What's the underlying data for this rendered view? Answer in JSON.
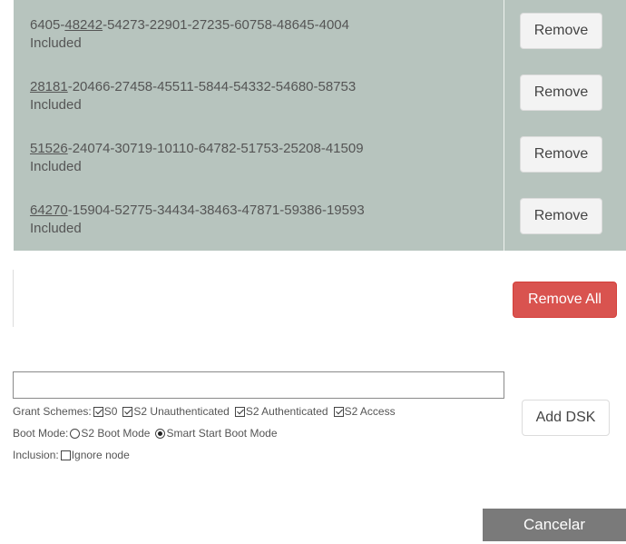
{
  "dsk_list": [
    {
      "prefix": "6405-",
      "underlined": "48242",
      "suffix": "-54273-22901-27235-60758-48645-4004",
      "status": "Included",
      "remove_label": "Remove"
    },
    {
      "prefix": "",
      "underlined": "28181",
      "suffix": "-20466-27458-45511-5844-54332-54680-58753",
      "status": "Included",
      "remove_label": "Remove"
    },
    {
      "prefix": "",
      "underlined": "51526",
      "suffix": "-24074-30719-10110-64782-51753-25208-41509",
      "status": "Included",
      "remove_label": "Remove"
    },
    {
      "prefix": "",
      "underlined": "64270",
      "suffix": "-15904-52775-34434-38463-47871-59386-19593",
      "status": "Included",
      "remove_label": "Remove"
    }
  ],
  "remove_all_label": "Remove All",
  "add_form": {
    "dsk_input_value": "",
    "grant_schemes": {
      "label": "Grant Schemes:",
      "options": [
        {
          "label": "S0",
          "checked": true
        },
        {
          "label": "S2 Unauthenticated",
          "checked": true
        },
        {
          "label": "S2 Authenticated",
          "checked": true
        },
        {
          "label": "S2 Access",
          "checked": true
        }
      ]
    },
    "boot_mode": {
      "label": "Boot Mode:",
      "options": [
        {
          "label": "S2 Boot Mode",
          "checked": false
        },
        {
          "label": "Smart Start Boot Mode",
          "checked": true
        }
      ]
    },
    "inclusion": {
      "label": "Inclusion:",
      "option": {
        "label": "Ignore node",
        "checked": false
      }
    },
    "add_label": "Add DSK"
  },
  "cancel_label": "Cancelar",
  "colors": {
    "table_bg": "#b7c4be",
    "danger": "#d9534f",
    "cancel_bg": "#7a7a7a"
  }
}
